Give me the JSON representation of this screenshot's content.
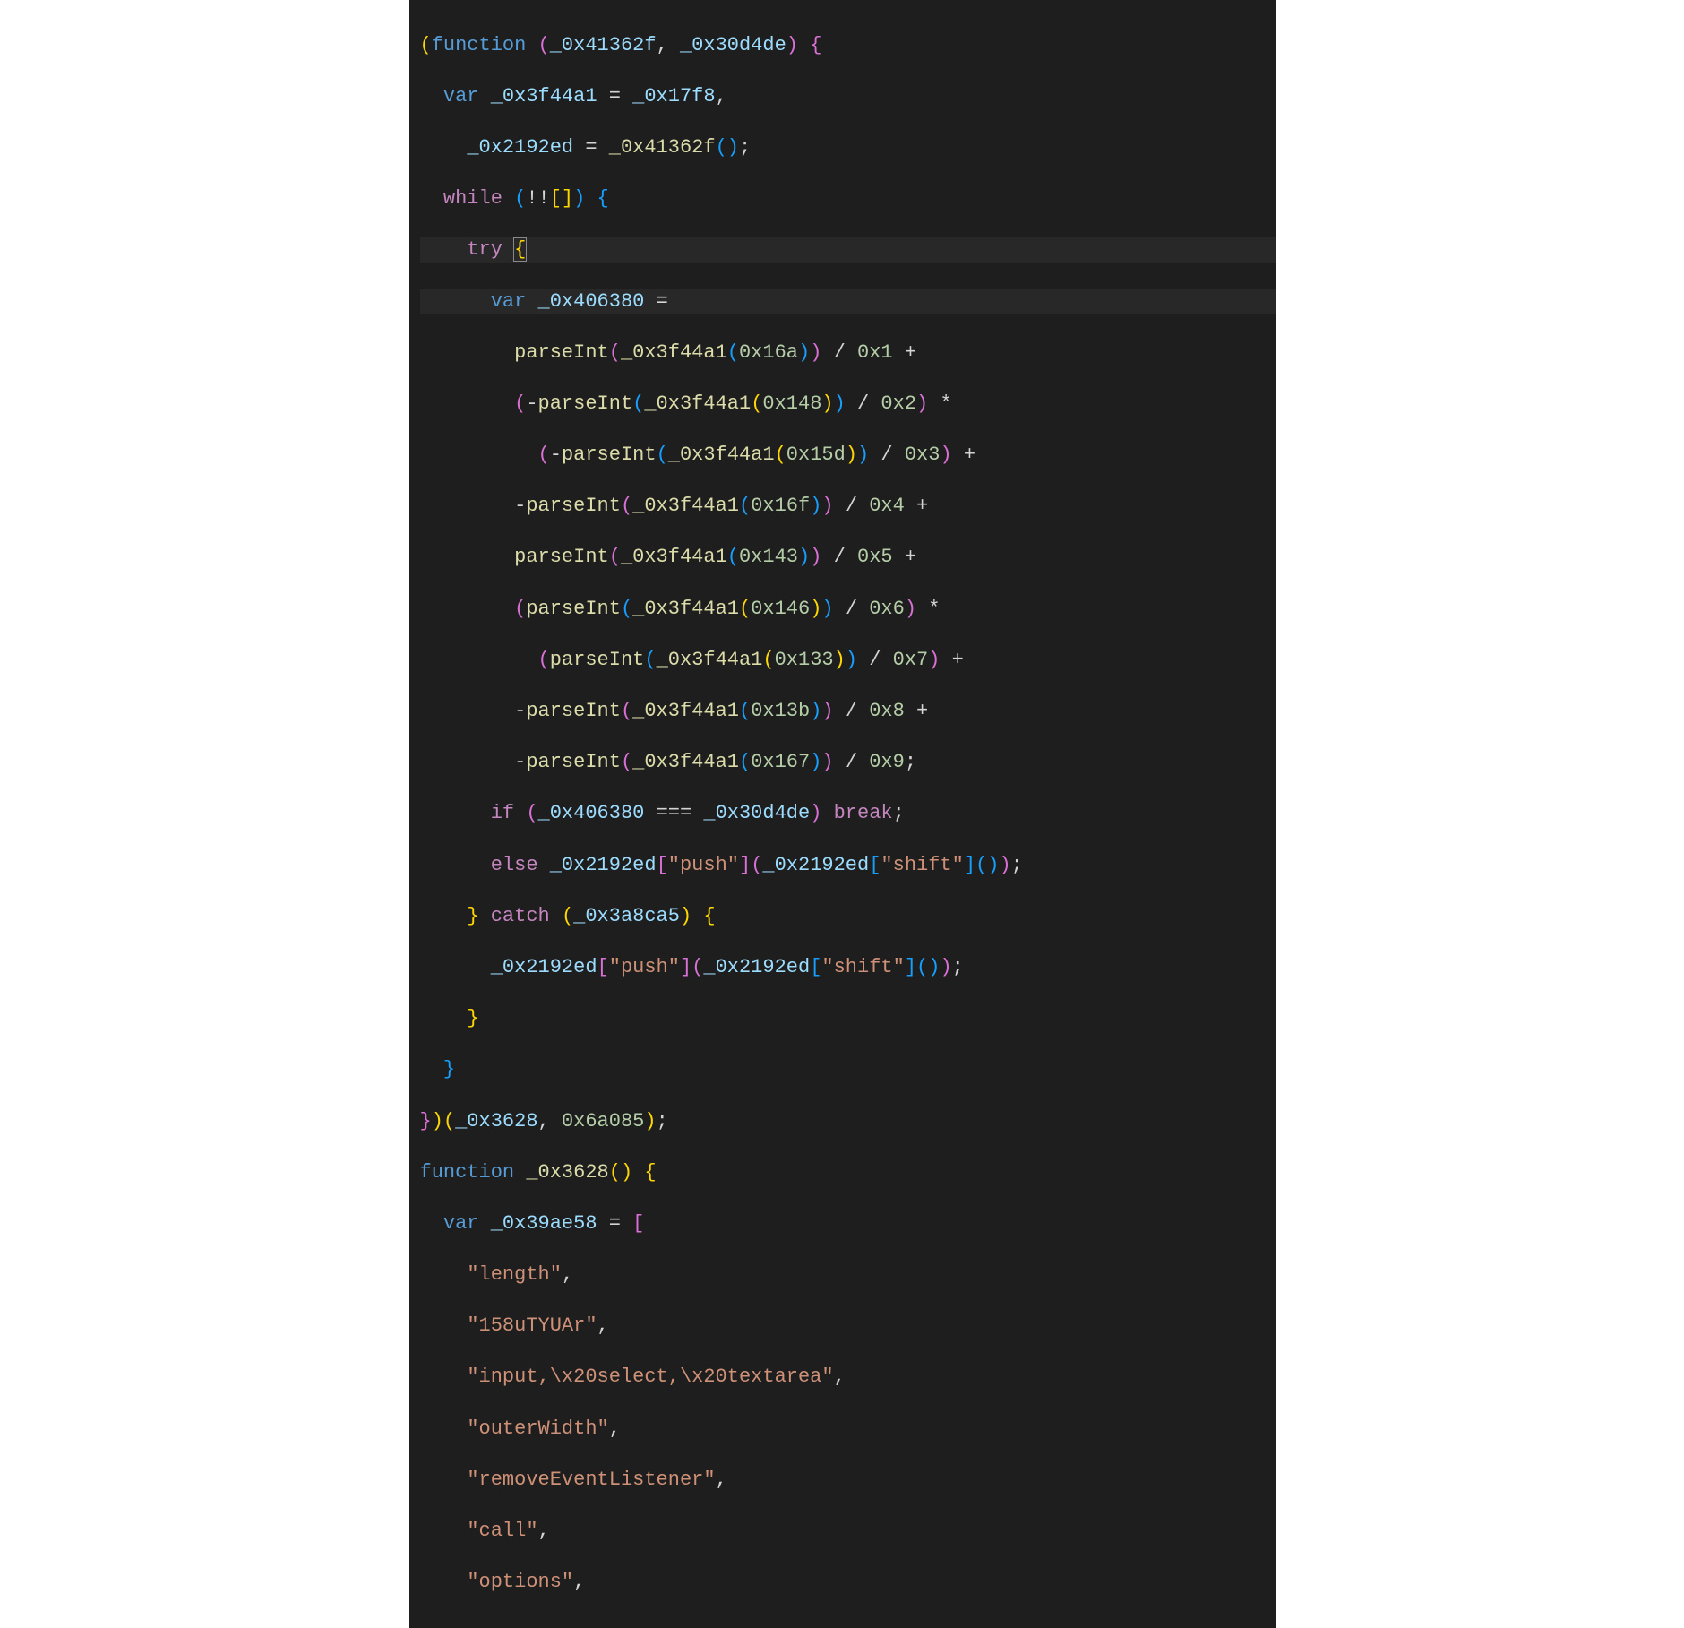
{
  "code": {
    "l1": {
      "kw_func": "function",
      "p1": "_0x41362f",
      "p2": "_0x30d4de"
    },
    "l2": {
      "kw_var": "var",
      "v1": "_0x3f44a1",
      "v2": "_0x17f8"
    },
    "l3": {
      "v1": "_0x2192ed",
      "v2": "_0x41362f"
    },
    "l4": {
      "kw_while": "while"
    },
    "l5": {
      "kw_try": "try"
    },
    "l6": {
      "kw_var": "var",
      "v1": "_0x406380"
    },
    "l7": {
      "fn": "parseInt",
      "v1": "_0x3f44a1",
      "n1": "0x16a",
      "n2": "0x1"
    },
    "l8": {
      "fn": "parseInt",
      "v1": "_0x3f44a1",
      "n1": "0x148",
      "n2": "0x2"
    },
    "l9": {
      "fn": "parseInt",
      "v1": "_0x3f44a1",
      "n1": "0x15d",
      "n2": "0x3"
    },
    "l10": {
      "fn": "parseInt",
      "v1": "_0x3f44a1",
      "n1": "0x16f",
      "n2": "0x4"
    },
    "l11": {
      "fn": "parseInt",
      "v1": "_0x3f44a1",
      "n1": "0x143",
      "n2": "0x5"
    },
    "l12": {
      "fn": "parseInt",
      "v1": "_0x3f44a1",
      "n1": "0x146",
      "n2": "0x6"
    },
    "l13": {
      "fn": "parseInt",
      "v1": "_0x3f44a1",
      "n1": "0x133",
      "n2": "0x7"
    },
    "l14": {
      "fn": "parseInt",
      "v1": "_0x3f44a1",
      "n1": "0x13b",
      "n2": "0x8"
    },
    "l15": {
      "fn": "parseInt",
      "v1": "_0x3f44a1",
      "n1": "0x167",
      "n2": "0x9"
    },
    "l16": {
      "kw_if": "if",
      "v1": "_0x406380",
      "v2": "_0x30d4de",
      "kw_break": "break"
    },
    "l17": {
      "kw_else": "else",
      "v1": "_0x2192ed",
      "s1": "\"push\"",
      "v2": "_0x2192ed",
      "s2": "\"shift\""
    },
    "l18": {
      "kw_catch": "catch",
      "v1": "_0x3a8ca5"
    },
    "l19": {
      "v1": "_0x2192ed",
      "s1": "\"push\"",
      "v2": "_0x2192ed",
      "s2": "\"shift\""
    },
    "l22": {
      "v1": "_0x3628",
      "n1": "0x6a085"
    },
    "l23": {
      "kw_func": "function",
      "fn": "_0x3628"
    },
    "l24": {
      "kw_var": "var",
      "v1": "_0x39ae58"
    },
    "l25": {
      "s": "\"length\""
    },
    "l26": {
      "s": "\"158uTYUAr\""
    },
    "l27": {
      "s": "\"input,\\x20select,\\x20textarea\""
    },
    "l28": {
      "s": "\"outerWidth\""
    },
    "l29": {
      "s": "\"removeEventListener\""
    },
    "l30": {
      "s": "\"call\""
    },
    "l31": {
      "s": "\"options\""
    }
  }
}
